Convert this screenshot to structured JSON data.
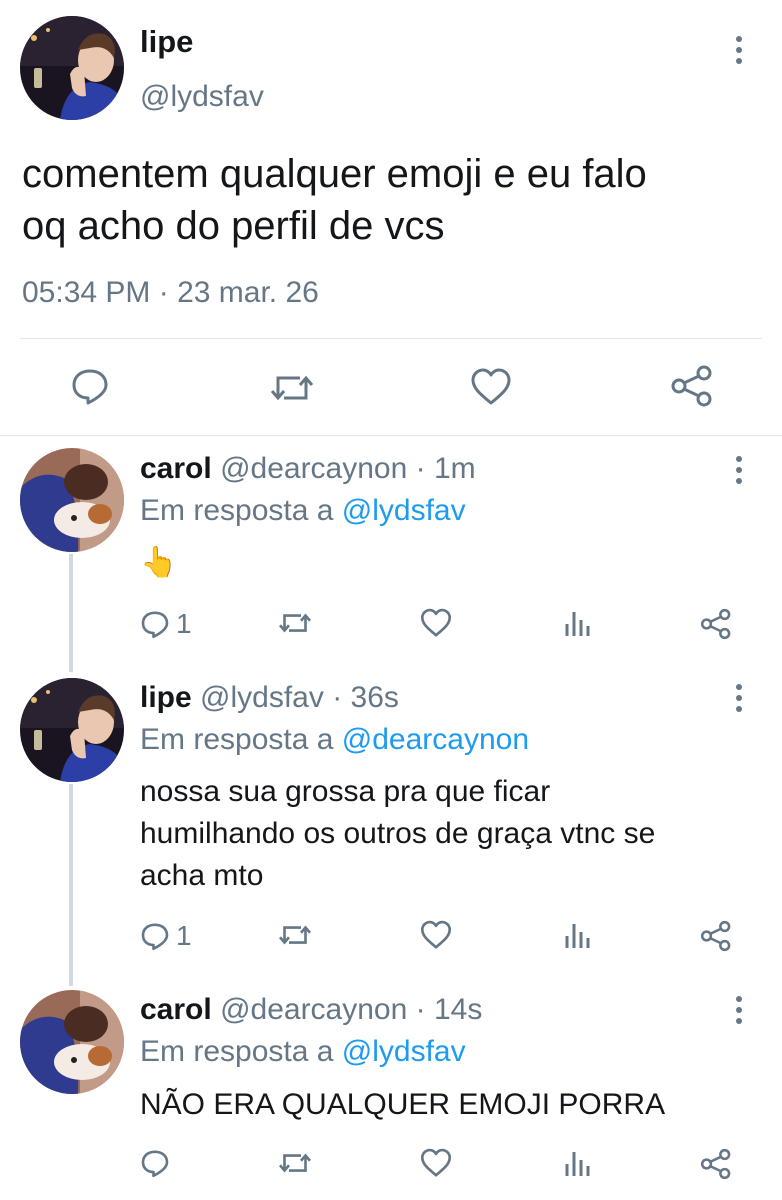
{
  "main_tweet": {
    "name": "lipe",
    "handle": "@lydsfav",
    "text_line1": "comentem qualquer emoji e eu falo",
    "text_line2": "oq acho do perfil de vcs",
    "timestamp": "05:34 PM · 23 mar. 26",
    "actions": [
      "reply-icon",
      "retweet-icon",
      "like-icon",
      "share-icon"
    ]
  },
  "replies": [
    {
      "name": "carol",
      "handle": "@dearcaynon",
      "time": "· 1m",
      "reply_prefix": "Em resposta a",
      "reply_to": "@lydsfav",
      "text_lines": [
        "👆"
      ],
      "reply_count": "1"
    },
    {
      "name": "lipe",
      "handle": "@lydsfav",
      "time": "· 36s",
      "reply_prefix": "Em resposta a",
      "reply_to": "@dearcaynon",
      "text_lines": [
        "nossa sua grossa pra que ficar",
        "humilhando os outros de graça vtnc se",
        "acha mto"
      ],
      "reply_count": "1"
    },
    {
      "name": "carol",
      "handle": "@dearcaynon",
      "time": "· 14s",
      "reply_prefix": "Em resposta a",
      "reply_to": "@lydsfav",
      "text_lines": [
        "NÃO ERA QUALQUER EMOJI PORRA"
      ],
      "reply_count": ""
    }
  ],
  "colors": {
    "text": "#14171a",
    "secondary": "#657786",
    "link": "#1d9bf0",
    "divider": "#e1e8ed"
  }
}
